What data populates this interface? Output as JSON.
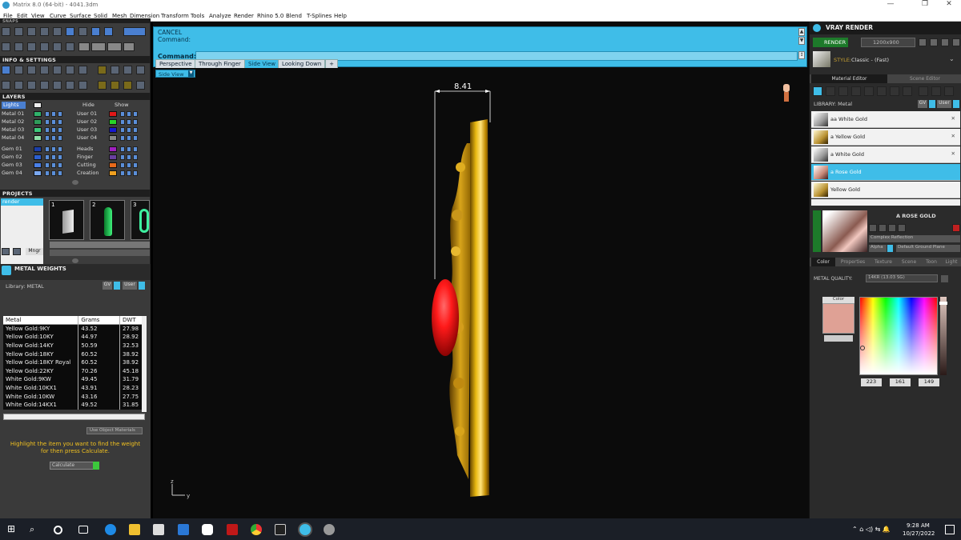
{
  "titlebar": {
    "title": "Matrix 8.0 (64-bit) - 4041.3dm",
    "min": "—",
    "max": "❐",
    "close": "✕"
  },
  "menu": [
    "File",
    "Edit",
    "View",
    "Curve",
    "Surface",
    "Solid",
    "Mesh",
    "Dimension",
    "Transform",
    "Tools",
    "Analyze",
    "Render",
    "Rhino 5.0",
    "Blend",
    "T-Splines",
    "Help"
  ],
  "left": {
    "snaps_label": "SNAPS",
    "info_label": "INFO & SETTINGS",
    "layers_label": "LAYERS",
    "lights_label": "Lights",
    "hide_label": "Hide",
    "show_label": "Show",
    "layers_left": [
      "Metal 01",
      "Metal 02",
      "Metal 03",
      "Metal 04",
      "Gem 01",
      "Gem 02",
      "Gem 03",
      "Gem 04"
    ],
    "layers_right": [
      "User 01",
      "User 02",
      "User 03",
      "User 04",
      "Heads",
      "Finger",
      "Cutting",
      "Creation"
    ],
    "projects_label": "PROJECTS",
    "project_item": "render",
    "thumbs": [
      "1",
      "2",
      "3"
    ],
    "mngr_label": "Mngr",
    "metal_weights_label": "METAL WEIGHTS",
    "library_label": "Library: METAL",
    "gv_label": "GV",
    "user_label": "User",
    "table": {
      "headers": [
        "Metal",
        "Grams",
        "DWT"
      ],
      "rows": [
        [
          "Yellow Gold:9KY",
          "43.52",
          "27.98"
        ],
        [
          "Yellow Gold:10KY",
          "44.97",
          "28.92"
        ],
        [
          "Yellow Gold:14KY",
          "50.59",
          "32.53"
        ],
        [
          "Yellow Gold:18KY",
          "60.52",
          "38.92"
        ],
        [
          "Yellow Gold:18KY Royal",
          "60.52",
          "38.92"
        ],
        [
          "Yellow Gold:22KY",
          "70.26",
          "45.18"
        ],
        [
          "White Gold:9KW",
          "49.45",
          "31.79"
        ],
        [
          "White Gold:10KX1",
          "43.91",
          "28.23"
        ],
        [
          "White Gold:10KW",
          "43.16",
          "27.75"
        ],
        [
          "White Gold:14KX1",
          "49.52",
          "31.85"
        ]
      ]
    },
    "use_object_materials": "Use Object Materials",
    "hint": "Highlight the item you want to find the weight for then press Calculate.",
    "calculate": "Calculate"
  },
  "viewport": {
    "cmd_line1": "CANCEL",
    "cmd_line2": "Command:",
    "cmd_label": "Command:",
    "tabs": [
      "Perspective",
      "Through Finger",
      "Side View",
      "Looking Down"
    ],
    "active_tab": "Side View",
    "view_dropdown": "Side View",
    "dimension": "8.41",
    "axis_z": "z",
    "axis_y": "y"
  },
  "right": {
    "title": "VRAY RENDER",
    "render_btn": "RENDER",
    "resolution": "1200x900",
    "style_label": "STYLE:",
    "style_value": "Classic - (Fast)",
    "tab_material": "Material Editor",
    "tab_scene": "Scene Editor",
    "library_label": "LIBRARY: Metal",
    "gv_label": "GV",
    "user_label": "User",
    "materials": [
      "aa White Gold",
      "a Yellow Gold",
      "a White Gold",
      "a Rose Gold",
      "Yellow Gold"
    ],
    "selected_material": "a Rose Gold",
    "preview_name": "A ROSE GOLD",
    "reflection": "Complex Reflection",
    "alpha_label": "Alpha",
    "ground_plane": "Default Ground Plane",
    "subtabs": [
      "Color",
      "Properties",
      "Texture",
      "Scene",
      "Toon",
      "Light"
    ],
    "metal_quality_label": "METAL QUALITY:",
    "metal_quality_value": "14KR    (13.03 SG)",
    "color_label": "Color",
    "rgb": [
      "223",
      "161",
      "149"
    ],
    "swatch_color": "#dfa195"
  },
  "taskbar": {
    "time": "9:28 AM",
    "date": "10/27/2022"
  }
}
